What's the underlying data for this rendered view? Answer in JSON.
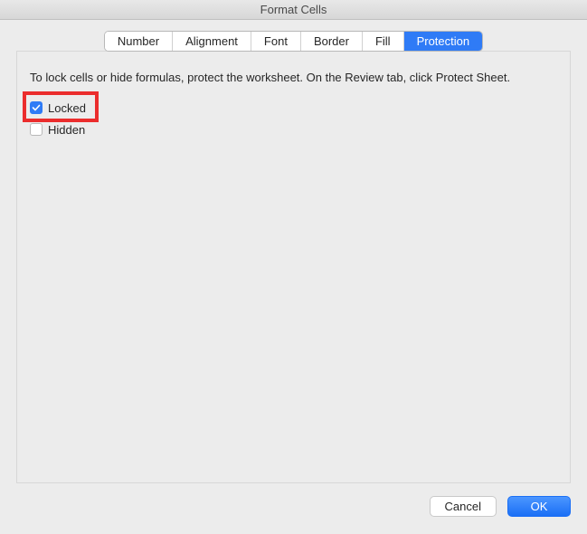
{
  "window": {
    "title": "Format Cells"
  },
  "tabs": [
    {
      "label": "Number",
      "active": false
    },
    {
      "label": "Alignment",
      "active": false
    },
    {
      "label": "Font",
      "active": false
    },
    {
      "label": "Border",
      "active": false
    },
    {
      "label": "Fill",
      "active": false
    },
    {
      "label": "Protection",
      "active": true
    }
  ],
  "instruction": "To lock cells or hide formulas, protect the worksheet. On the Review tab, click Protect Sheet.",
  "options": {
    "locked": {
      "label": "Locked",
      "checked": true,
      "highlighted": true
    },
    "hidden": {
      "label": "Hidden",
      "checked": false,
      "highlighted": false
    }
  },
  "buttons": {
    "cancel": "Cancel",
    "ok": "OK"
  },
  "colors": {
    "accent": "#2f7bf6",
    "highlight": "#eb2d2d"
  }
}
